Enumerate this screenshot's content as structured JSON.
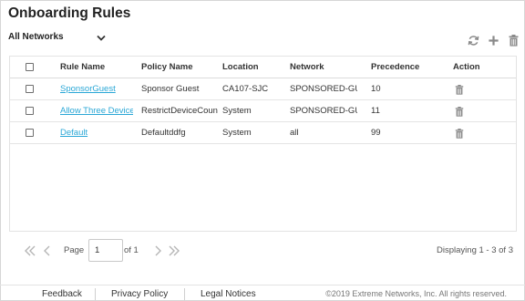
{
  "page": {
    "title": "Onboarding Rules"
  },
  "filter": {
    "selected": "All Networks"
  },
  "toolbar": {
    "icons": [
      "refresh-icon",
      "add-icon",
      "trash-icon"
    ]
  },
  "table": {
    "headers": {
      "rule_name": "Rule Name",
      "policy_name": "Policy Name",
      "location": "Location",
      "network": "Network",
      "precedence": "Precedence",
      "action": "Action"
    },
    "rows": [
      {
        "rule_name": "SponsorGuest",
        "policy_name": "Sponsor Guest",
        "location": "CA107-SJC",
        "network": "SPONSORED-GUEST",
        "precedence": "10"
      },
      {
        "rule_name": "Allow Three Devices",
        "policy_name": "RestrictDeviceCount",
        "location": "System",
        "network": "SPONSORED-GUEST",
        "precedence": "11"
      },
      {
        "rule_name": "Default",
        "policy_name": "Defaultddfg",
        "location": "System",
        "network": "all",
        "precedence": "99"
      }
    ]
  },
  "pager": {
    "page_label": "Page",
    "current_page": "1",
    "of_label": "of 1",
    "info": "Displaying 1 - 3 of 3"
  },
  "footer": {
    "feedback": "Feedback",
    "privacy": "Privacy Policy",
    "legal": "Legal Notices",
    "copyright": "©2019 Extreme Networks, Inc. All rights reserved."
  },
  "colors": {
    "link": "#2aa7d6",
    "icon": "#8a8a8a"
  }
}
